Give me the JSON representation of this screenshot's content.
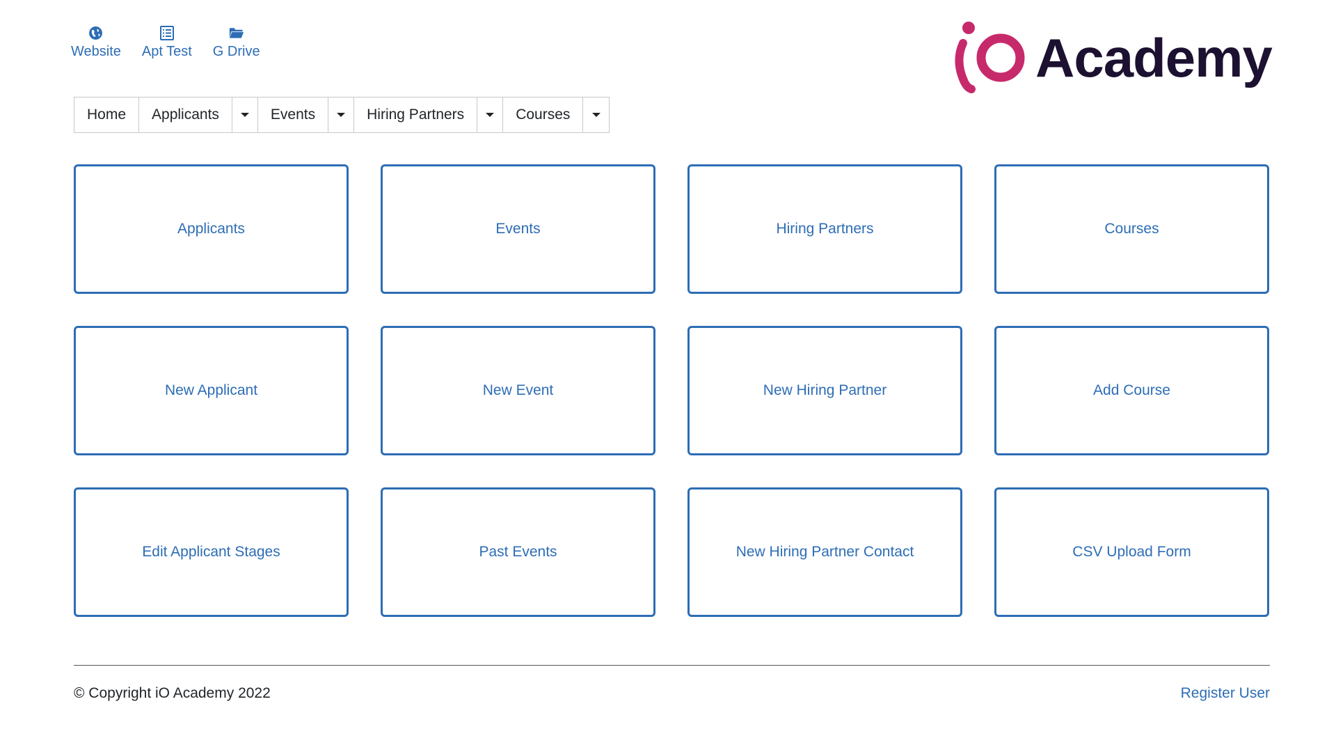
{
  "quick_links": [
    {
      "label": "Website",
      "icon": "globe-icon"
    },
    {
      "label": "Apt Test",
      "icon": "list-icon"
    },
    {
      "label": "G Drive",
      "icon": "folder-open-icon"
    }
  ],
  "logo": {
    "text": "Academy",
    "mark_color": "#c72a6b",
    "text_color": "#1c1130"
  },
  "nav": {
    "home": "Home",
    "applicants": "Applicants",
    "events": "Events",
    "hiring_partners": "Hiring Partners",
    "courses": "Courses"
  },
  "cards": [
    "Applicants",
    "Events",
    "Hiring Partners",
    "Courses",
    "New Applicant",
    "New Event",
    "New Hiring Partner",
    "Add Course",
    "Edit Applicant Stages",
    "Past Events",
    "New Hiring Partner Contact",
    "CSV Upload Form"
  ],
  "footer": {
    "copyright": "© Copyright iO Academy 2022",
    "register": "Register User"
  },
  "colors": {
    "accent": "#2d6db5"
  }
}
